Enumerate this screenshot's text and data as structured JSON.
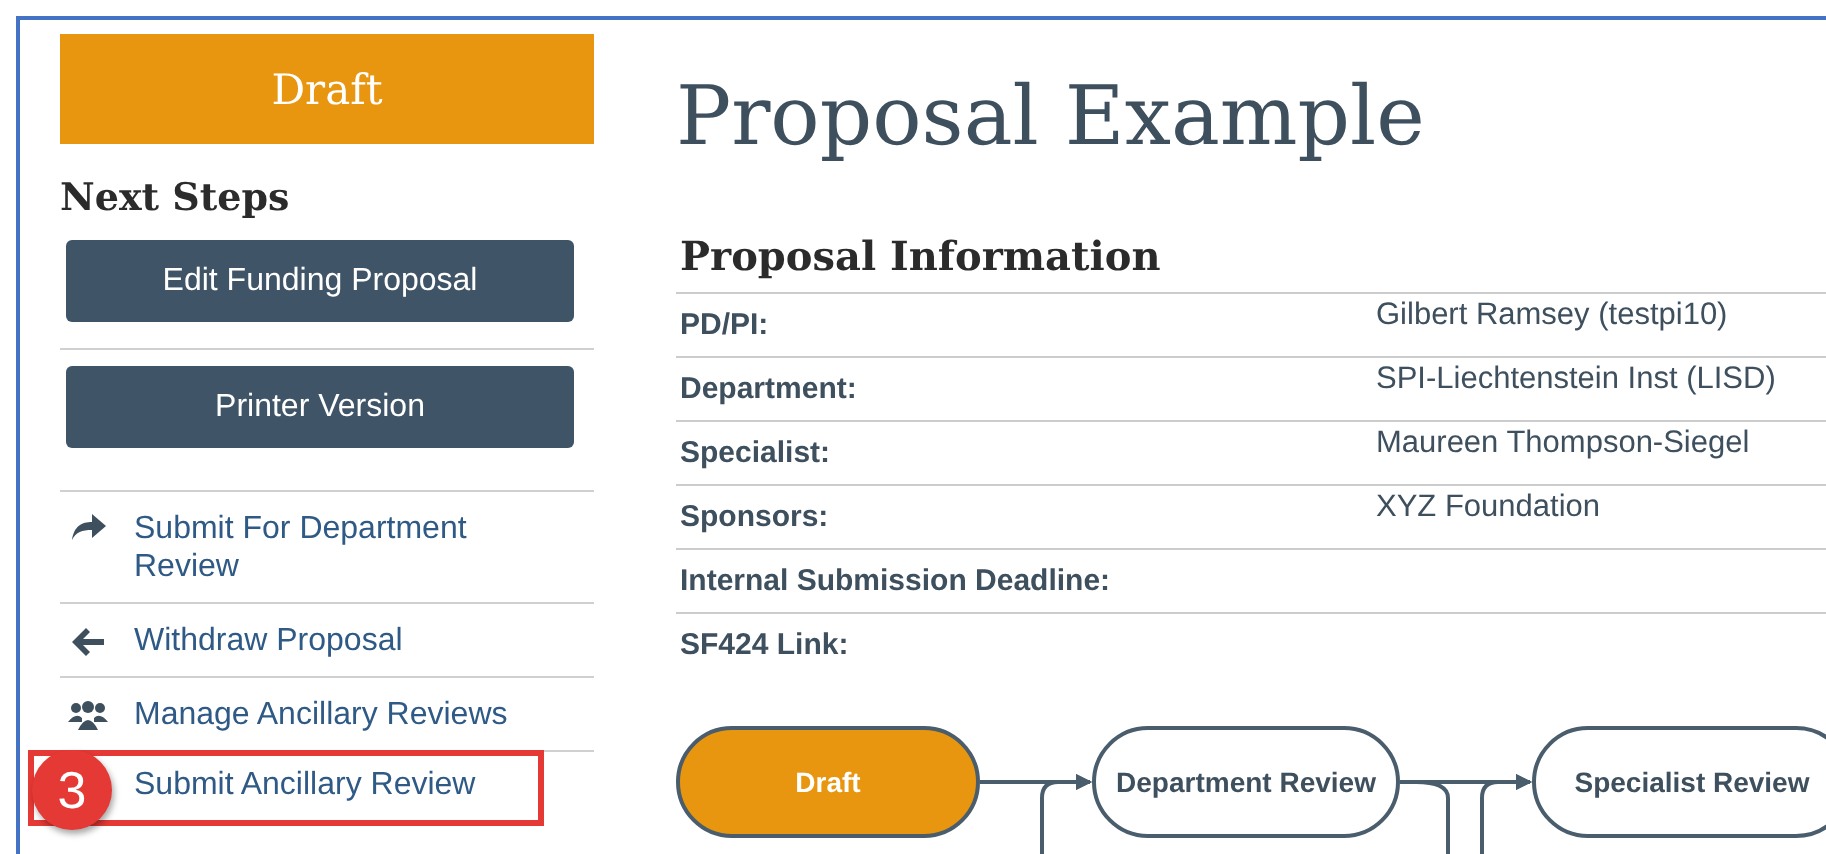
{
  "status": {
    "label": "Draft"
  },
  "next_steps": {
    "title": "Next Steps",
    "buttons": [
      "Edit Funding Proposal",
      "Printer Version"
    ],
    "actions": [
      {
        "label": "Submit For Department Review",
        "kind": "forward",
        "highlighted": false
      },
      {
        "label": "Withdraw Proposal",
        "kind": "back",
        "highlighted": false
      },
      {
        "label": "Manage Ancillary Reviews",
        "kind": "people",
        "highlighted": false
      },
      {
        "label": "Submit Ancillary Review",
        "kind": "none",
        "highlighted": true
      }
    ],
    "callout_badge": "3"
  },
  "page_title": "Proposal Example",
  "proposal_information": {
    "title": "Proposal Information",
    "rows": [
      {
        "label": "PD/PI:",
        "value": "Gilbert Ramsey (testpi10)"
      },
      {
        "label": "Department:",
        "value": "SPI-Liechtenstein Inst (LISD)"
      },
      {
        "label": "Specialist:",
        "value": "Maureen Thompson-Siegel"
      },
      {
        "label": "Sponsors:",
        "value": "XYZ Foundation"
      },
      {
        "label": "Internal Submission Deadline:"
      },
      {
        "label": "SF424 Link:"
      }
    ]
  },
  "workflow": {
    "states": [
      {
        "label": "Draft",
        "selected": true
      },
      {
        "label": "Department Review",
        "selected": false
      },
      {
        "label": "Specialist Review",
        "selected": false
      }
    ]
  }
}
